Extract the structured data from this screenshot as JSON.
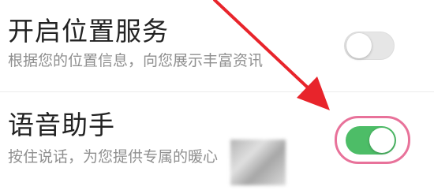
{
  "settings": {
    "location_service": {
      "title": "开启位置服务",
      "description": "根据您的位置信息，向您展示丰富资讯",
      "enabled": false
    },
    "voice_assistant": {
      "title": "语音助手",
      "description": "按住说话，为您提供专属的暖心",
      "enabled": true
    }
  },
  "annotation": {
    "arrow_color": "#e8242b",
    "highlight_color": "#e8729a"
  },
  "colors": {
    "switch_on": "#4dbd67",
    "switch_off": "#e6e6e6"
  }
}
